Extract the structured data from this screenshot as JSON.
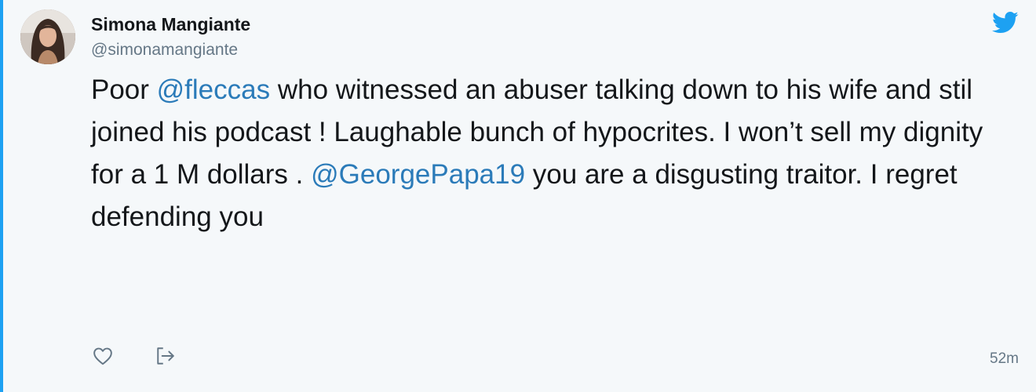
{
  "author": {
    "display_name": "Simona Mangiante",
    "handle": "@simonamangiante",
    "avatar_icon": "profile-photo"
  },
  "tweet": {
    "segments": [
      {
        "type": "text",
        "value": "Poor "
      },
      {
        "type": "mention",
        "value": "@fleccas"
      },
      {
        "type": "text",
        "value": " who witnessed an abuser talking down to his wife and stil joined his podcast ! Laughable bunch of hypocrites. I won’t sell my dignity for a 1 M dollars . "
      },
      {
        "type": "mention",
        "value": "@GeorgePapa19"
      },
      {
        "type": "text",
        "value": " you are a disgusting traitor. I regret defending you"
      }
    ]
  },
  "actions": {
    "like_icon": "heart-icon",
    "share_icon": "share-icon"
  },
  "timestamp": "52m",
  "colors": {
    "background": "#f5f8fa",
    "accent": "#1da1f2",
    "mention": "#2b7bb9",
    "muted": "#657786",
    "text": "#14171a"
  }
}
